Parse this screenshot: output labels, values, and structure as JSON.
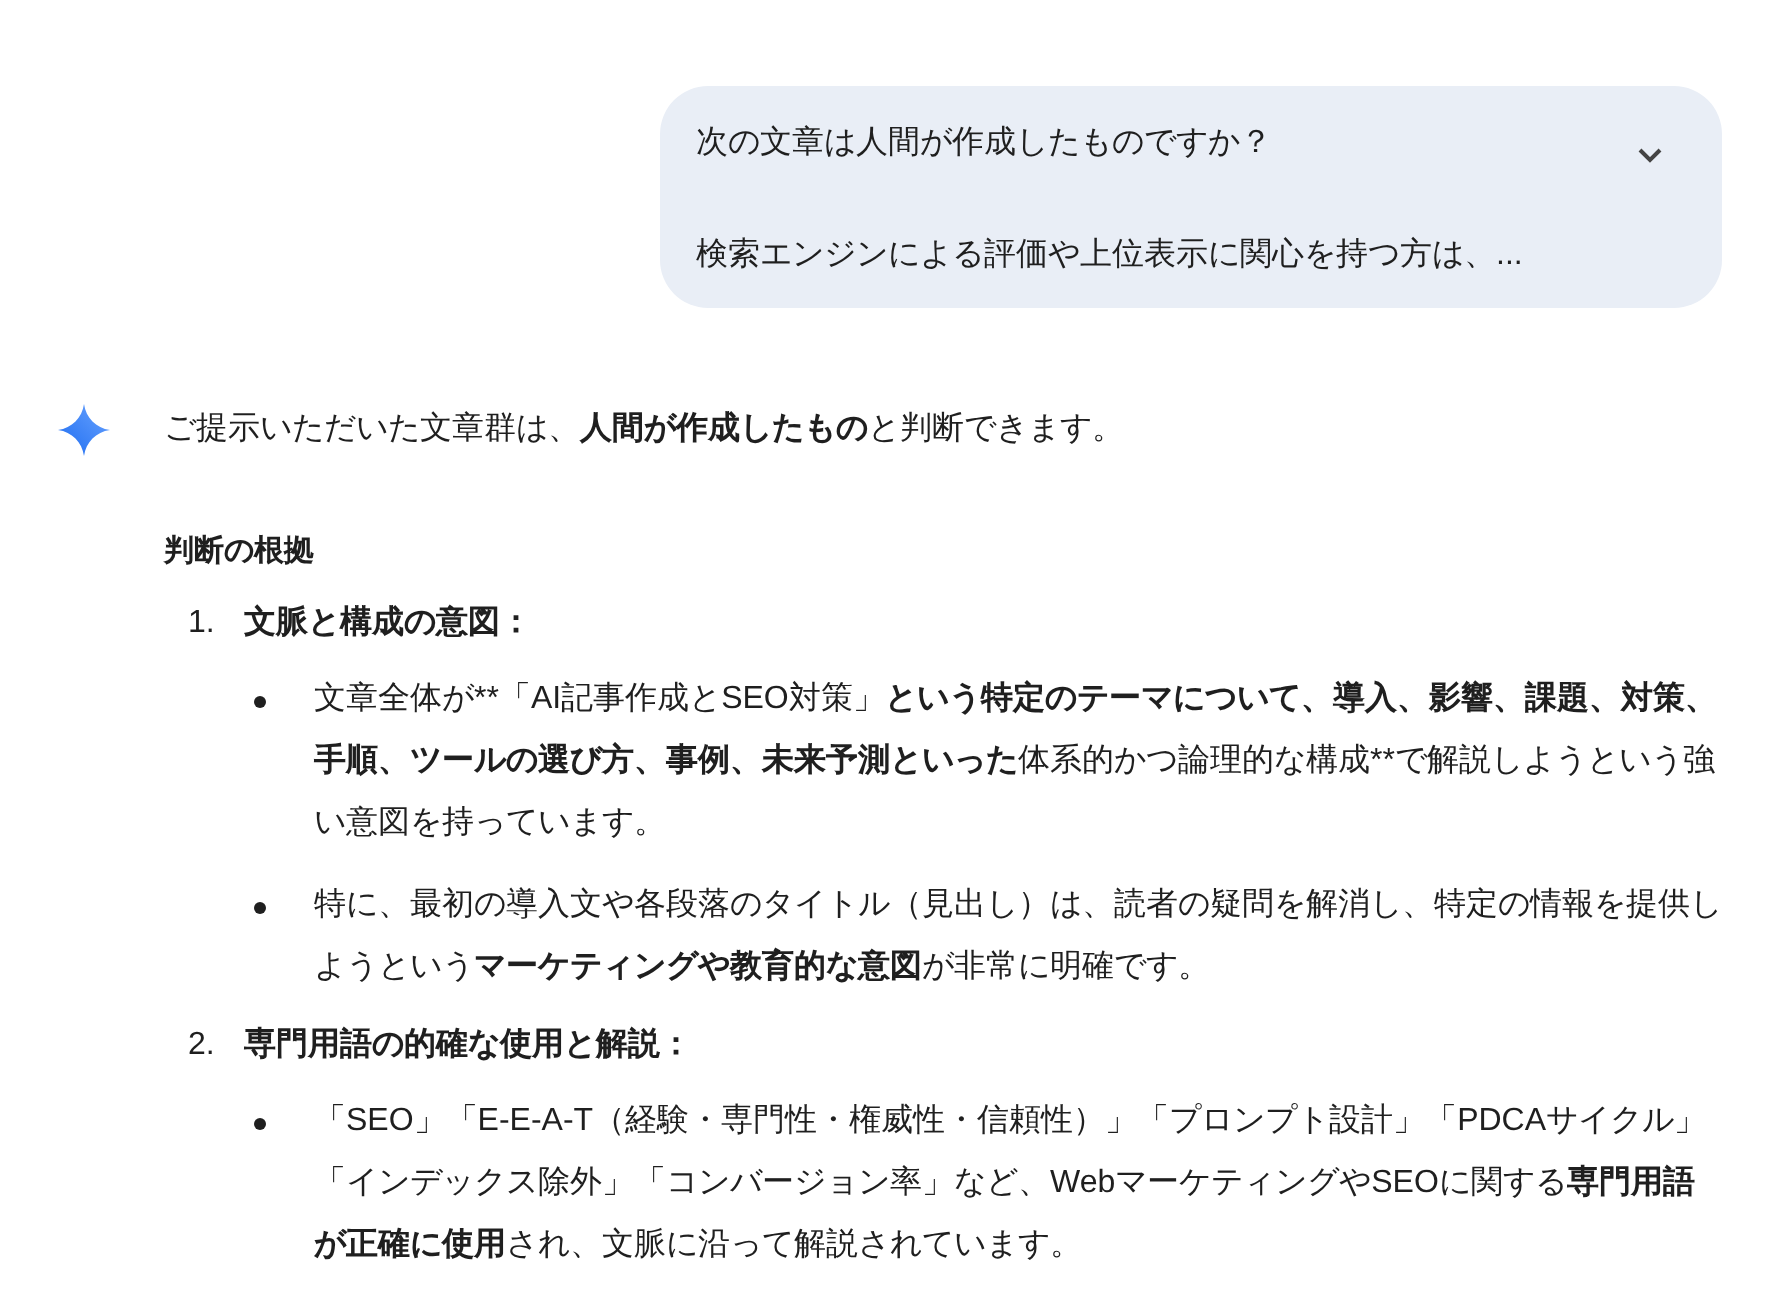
{
  "prompt": {
    "lines": [
      "次の文章は人間が作成したものですか？",
      "検索エンジンによる評価や上位表示に関心を持つ方は、..."
    ],
    "expanded": false
  },
  "response": {
    "intro": [
      {
        "text": "ご提示いただいた文章群は、",
        "bold": false
      },
      {
        "text": "人間が作成したもの",
        "bold": true
      },
      {
        "text": "と判断できます。",
        "bold": false
      }
    ],
    "heading": "判断の根拠",
    "items": [
      {
        "number": "1.",
        "title": "文脈と構成の意図：",
        "bullets": [
          [
            {
              "text": "文章全体が**「AI記事作成とSEO対策」",
              "bold": false
            },
            {
              "text": "という特定のテーマについて、導入、影響、課題、対策、手順、ツールの選び方、事例、未来予測といった",
              "bold": true
            },
            {
              "text": "体系的かつ論理的な構成**で解説しようという強い意図を持っています。",
              "bold": false
            }
          ],
          [
            {
              "text": "特に、最初の導入文や各段落のタイトル（見出し）は、読者の疑問を解消し、特定の情報を提供しようという",
              "bold": false
            },
            {
              "text": "マーケティングや教育的な意図",
              "bold": true
            },
            {
              "text": "が非常に明確です。",
              "bold": false
            }
          ]
        ]
      },
      {
        "number": "2.",
        "title": "専門用語の的確な使用と解説：",
        "bullets": [
          [
            {
              "text": "「SEO」「E-E-A-T（経験・専門性・権威性・信頼性）」「プロンプト設計」「PDCAサイクル」「インデックス除外」「コンバージョン率」など、WebマーケティングやSEOに関する",
              "bold": false
            },
            {
              "text": "専門用語が正確に使用",
              "bold": true
            },
            {
              "text": "され、文脈に沿って解説されています。",
              "bold": false
            }
          ]
        ]
      }
    ]
  }
}
